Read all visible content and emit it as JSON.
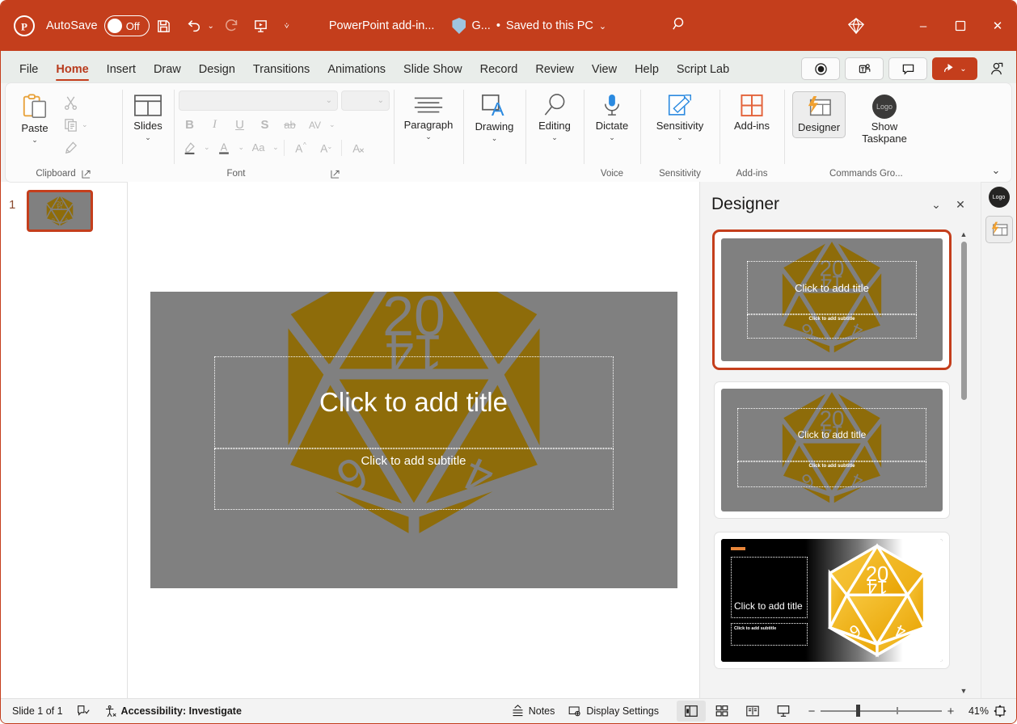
{
  "titlebar": {
    "app_icon": "powerpoint-logo-icon",
    "autosave_label": "AutoSave",
    "autosave_state": "Off",
    "save_icon": "save-icon",
    "undo_icon": "undo-icon",
    "redo_icon": "redo-icon",
    "present_icon": "start-presentation-icon",
    "customize_caret": "customize-quick-access-toolbar-icon",
    "document_title": "PowerPoint add-in...",
    "sensitivity_label": "G...",
    "separator": "•",
    "save_state": "Saved to this PC",
    "search_icon": "search-icon",
    "diamond_icon": "copilot-icon",
    "minimize": "–",
    "maximize": "▢",
    "close": "✕",
    "accent": "#c43e1c"
  },
  "ribbon_tabs": {
    "tabs": [
      {
        "label": "File",
        "active": false
      },
      {
        "label": "Home",
        "active": true
      },
      {
        "label": "Insert",
        "active": false
      },
      {
        "label": "Draw",
        "active": false
      },
      {
        "label": "Design",
        "active": false
      },
      {
        "label": "Transitions",
        "active": false
      },
      {
        "label": "Animations",
        "active": false
      },
      {
        "label": "Slide Show",
        "active": false
      },
      {
        "label": "Record",
        "active": false
      },
      {
        "label": "Review",
        "active": false
      },
      {
        "label": "View",
        "active": false
      },
      {
        "label": "Help",
        "active": false
      },
      {
        "label": "Script Lab",
        "active": false
      }
    ],
    "record_button": "record-button",
    "teams_button": "teams-button",
    "comments_button": "comments-button",
    "share_button": "share-button",
    "people_button": "people-icon"
  },
  "ribbon": {
    "clipboard": {
      "group_label": "Clipboard",
      "paste_label": "Paste",
      "cut_icon": "cut-icon",
      "copy_icon": "copy-icon",
      "format_painter_icon": "format-painter-icon",
      "dialog_launcher": "dialog-box-launcher-icon"
    },
    "slides": {
      "slides_label": "Slides"
    },
    "font": {
      "group_label": "Font",
      "font_name_value": "",
      "font_size_value": "",
      "bold": "B",
      "italic": "I",
      "underline": "U",
      "shadow": "S",
      "strikethrough": "ab",
      "char_spacing": "AV",
      "text_highlight_icon": "text-highlight-color-icon",
      "font_color_icon": "font-color-icon",
      "change_case": "Aa",
      "increase_size": "A",
      "decrease_size": "A",
      "clear_formatting_icon": "clear-all-formatting-icon",
      "dialog_launcher": "dialog-box-launcher-icon"
    },
    "paragraph": {
      "label": "Paragraph"
    },
    "drawing": {
      "label": "Drawing"
    },
    "editing": {
      "label": "Editing"
    },
    "voice": {
      "group_label": "Voice",
      "dictate_label": "Dictate"
    },
    "sensitivity": {
      "group_label": "Sensitivity",
      "label": "Sensitivity"
    },
    "addins": {
      "group_label": "Add-ins",
      "label": "Add-ins"
    },
    "commands": {
      "group_label": "Commands Gro...",
      "designer_label": "Designer",
      "taskpane_label": "Show Taskpane",
      "taskpane_logo_text": "Logo"
    },
    "collapse_icon": "ribbon-collapse-icon"
  },
  "thumbnails": {
    "slides": [
      {
        "number": "1",
        "selected": true
      }
    ]
  },
  "slide": {
    "title_placeholder": "Click to add title",
    "subtitle_placeholder": "Click to add subtitle",
    "background_color": "#808080",
    "art_color": "#8e6c0a",
    "art_name": "d20-dice-icosahedron",
    "dice_faces": [
      "20",
      "14",
      "6",
      "4"
    ]
  },
  "designer": {
    "title": "Designer",
    "collapse_icon": "chevron-down-icon",
    "close_icon": "close-icon",
    "scroll_up_icon": "scroll-up-arrow",
    "scroll_down_icon": "scroll-down-arrow",
    "ideas": [
      {
        "selected": true,
        "style": "grey",
        "title_placeholder": "Click to add title",
        "subtitle_placeholder": "Click to add subtitle"
      },
      {
        "selected": false,
        "style": "grey",
        "title_placeholder": "Click to add title",
        "subtitle_placeholder": "Click to add subtitle"
      },
      {
        "selected": false,
        "style": "dark",
        "title_placeholder": "Click to add title",
        "subtitle_placeholder": "Click to add subtitle"
      }
    ]
  },
  "right_rail": {
    "logo_text": "Logo",
    "designer_icon": "designer-taskpane-icon"
  },
  "status_bar": {
    "slide_count": "Slide 1 of 1",
    "language_icon": "spell-check-icon",
    "accessibility_icon": "accessibility-icon",
    "accessibility_text": "Accessibility: Investigate",
    "notes_label": "Notes",
    "notes_icon": "notes-icon",
    "display_settings_label": "Display Settings",
    "display_settings_icon": "display-settings-icon",
    "view_normal": "normal-view-icon",
    "view_sorter": "slide-sorter-icon",
    "view_reading": "reading-view-icon",
    "view_slideshow": "slide-show-icon",
    "zoom_out": "−",
    "zoom_in": "+",
    "zoom_level": "41%",
    "fit_icon": "fit-slide-to-window-icon"
  }
}
